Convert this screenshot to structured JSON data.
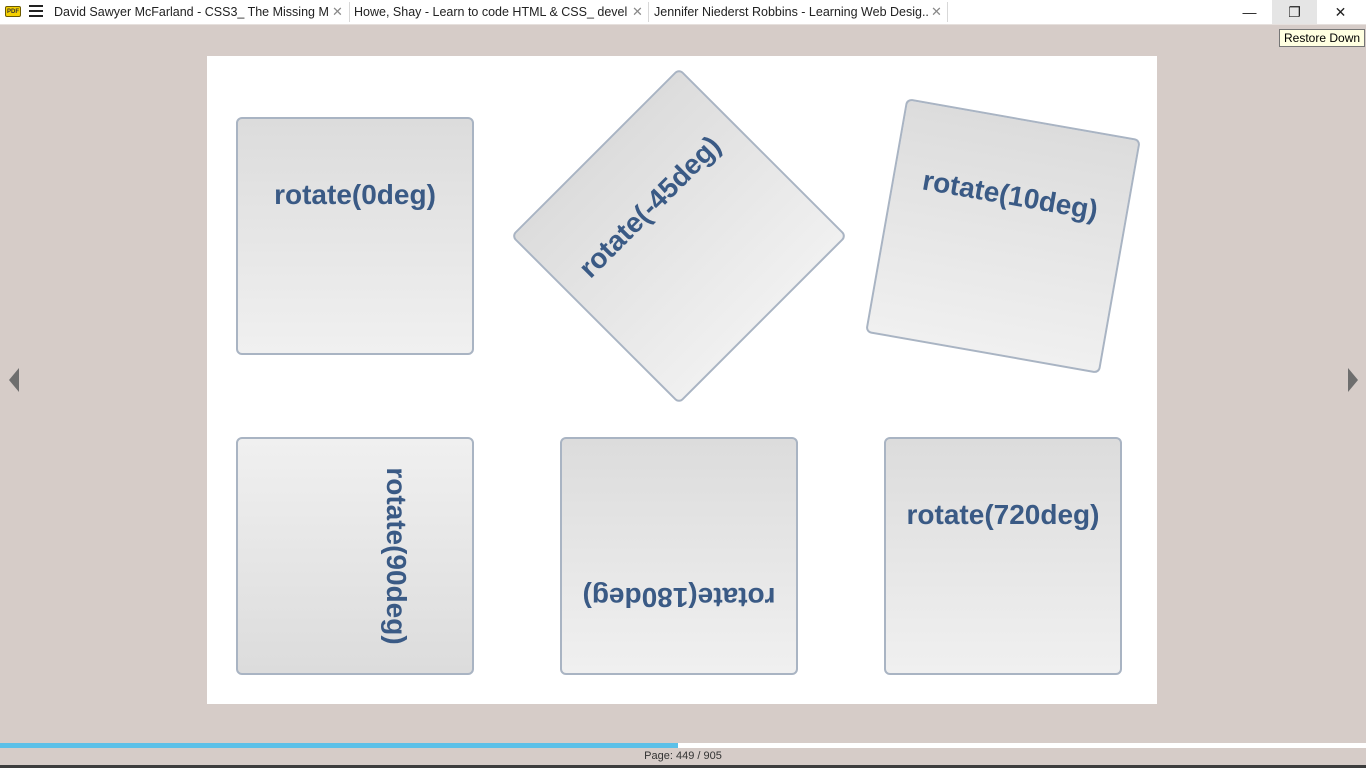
{
  "titlebar": {
    "app_icon_text": "PDF",
    "tabs": [
      {
        "label": "David Sawyer McFarland - CSS3_ The Missing M..."
      },
      {
        "label": "Howe, Shay - Learn to code HTML & CSS_ devel..."
      },
      {
        "label": "Jennifer Niederst Robbins - Learning Web Desig..."
      }
    ],
    "tab_close_glyph": "✕",
    "minimize_glyph": "—",
    "restore_glyph": "❐",
    "close_glyph": "✕",
    "tooltip": "Restore Down"
  },
  "page": {
    "boxes": [
      {
        "label": "rotate(0deg)",
        "rotation_deg": 0
      },
      {
        "label": "rotate(-45deg)",
        "rotation_deg": -45
      },
      {
        "label": "rotate(10deg)",
        "rotation_deg": 10
      },
      {
        "label": "rotate(90deg)",
        "rotation_deg": 90
      },
      {
        "label": "rotate(180deg)",
        "rotation_deg": 180
      },
      {
        "label": "rotate(720deg)",
        "rotation_deg": 720
      }
    ]
  },
  "footer": {
    "progress": 0.496,
    "page_text": "Page: 449 / 905"
  },
  "colors": {
    "background": "#d6ccc8",
    "box_border": "#a9b4c3",
    "label": "#3a5a85",
    "progress": "#5bc0e8"
  }
}
